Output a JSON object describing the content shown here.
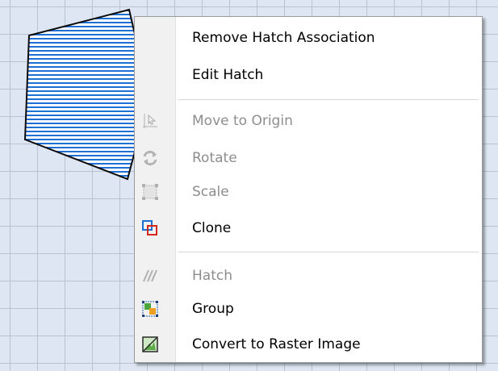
{
  "menu": {
    "items": [
      {
        "label": "Remove Hatch Association",
        "enabled": true,
        "icon": null
      },
      {
        "label": "Edit Hatch",
        "enabled": true,
        "icon": null
      },
      {
        "label": "Move to Origin",
        "enabled": false,
        "icon": "move-to-origin-icon"
      },
      {
        "label": "Rotate",
        "enabled": false,
        "icon": "rotate-icon"
      },
      {
        "label": "Scale",
        "enabled": false,
        "icon": "scale-icon"
      },
      {
        "label": "Clone",
        "enabled": true,
        "icon": "clone-icon"
      },
      {
        "label": "Hatch",
        "enabled": false,
        "icon": "hatch-icon"
      },
      {
        "label": "Group",
        "enabled": true,
        "icon": "group-icon"
      },
      {
        "label": "Convert to Raster Image",
        "enabled": true,
        "icon": "convert-to-raster-icon"
      }
    ]
  },
  "colors": {
    "canvas": "#dde6f2",
    "hatch_fill": "#1e6fd6",
    "menu_background": "#ffffff",
    "disabled_text": "#8d8d8d"
  }
}
